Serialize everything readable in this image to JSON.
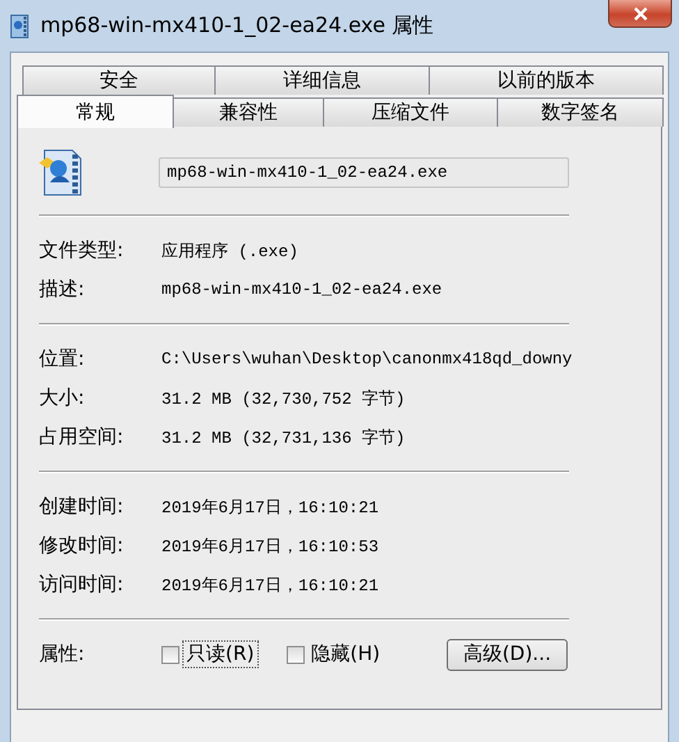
{
  "window": {
    "title": "mp68-win-mx410-1_02-ea24.exe 属性"
  },
  "tab_rows": [
    [
      {
        "label": "安全",
        "selected": false
      },
      {
        "label": "详细信息",
        "selected": false
      },
      {
        "label": "以前的版本",
        "selected": false
      }
    ],
    [
      {
        "label": "常规",
        "selected": true
      },
      {
        "label": "兼容性",
        "selected": false
      },
      {
        "label": "压缩文件",
        "selected": false
      },
      {
        "label": "数字签名",
        "selected": false
      }
    ]
  ],
  "file_name": {
    "value": "mp68-win-mx410-1_02-ea24.exe"
  },
  "groups": [
    [
      {
        "label": "文件类型:",
        "value": "应用程序 (.exe)"
      },
      {
        "label": "描述:",
        "value": "mp68-win-mx410-1_02-ea24.exe"
      }
    ],
    [
      {
        "label": "位置:",
        "value": "C:\\Users\\wuhan\\Desktop\\canonmx418qd_downy"
      },
      {
        "label": "大小:",
        "value": "31.2 MB (32,730,752 字节)"
      },
      {
        "label": "占用空间:",
        "value": "31.2 MB (32,731,136 字节)"
      }
    ],
    [
      {
        "label": "创建时间:",
        "value": "2019年6月17日，16:10:21"
      },
      {
        "label": "修改时间:",
        "value": "2019年6月17日，16:10:53"
      },
      {
        "label": "访问时间:",
        "value": "2019年6月17日，16:10:21"
      }
    ]
  ],
  "attributes": {
    "label": "属性:",
    "checkboxes": [
      {
        "label": "只读(R)",
        "checked": false,
        "focused": true
      },
      {
        "label": "隐藏(H)",
        "checked": false,
        "focused": false
      }
    ],
    "button": "高级(D)..."
  }
}
